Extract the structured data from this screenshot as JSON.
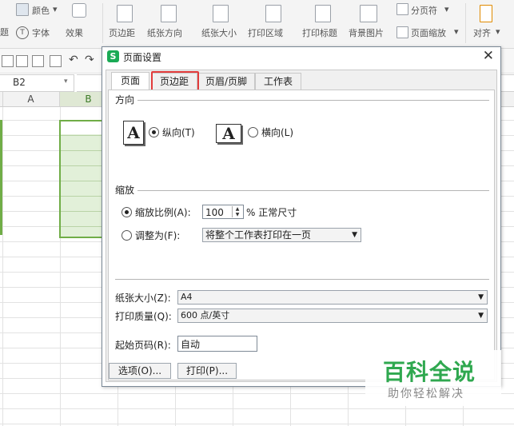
{
  "ribbon": {
    "color_label": "颜色",
    "font_label": "字体",
    "effect_label": "效果",
    "margins_label": "页边距",
    "orientation_label": "纸张方向",
    "size_label": "纸张大小",
    "print_area_label": "打印区域",
    "print_titles_label": "打印标题",
    "background_label": "背景图片",
    "page_break_label": "分页符",
    "page_zoom_label": "页面缩放",
    "align_label": "对齐",
    "left_cut_label": "题"
  },
  "namebox": {
    "value": "B2"
  },
  "columns": [
    "A",
    "B"
  ],
  "dialog": {
    "title": "页面设置",
    "close": "✕",
    "tabs": [
      "页面",
      "页边距",
      "页眉/页脚",
      "工作表"
    ],
    "orientation": {
      "section": "方向",
      "portrait_label": "纵向(T)",
      "landscape_label": "横向(L)",
      "icon_letter": "A"
    },
    "scaling": {
      "section": "缩放",
      "adjust_to_label": "缩放比例(A):",
      "adjust_to_value": "100",
      "percent_suffix": "% 正常尺寸",
      "fit_to_label": "调整为(F):",
      "fit_to_value": "将整个工作表打印在一页"
    },
    "paper_size_label": "纸张大小(Z):",
    "paper_size_value": "A4",
    "print_quality_label": "打印质量(Q):",
    "print_quality_value": "600 点/英寸",
    "first_page_label": "起始页码(R):",
    "first_page_value": "自动",
    "options_button": "选项(O)...",
    "print_button": "打印(P)..."
  },
  "watermark": {
    "brand": "百科全说",
    "tagline": "助你轻松解决"
  },
  "colors": {
    "selection_fill": "#e2f0d9",
    "selection_border": "#70ad47",
    "highlight_red": "#e23b3b",
    "brand_green": "#2fa84f"
  }
}
